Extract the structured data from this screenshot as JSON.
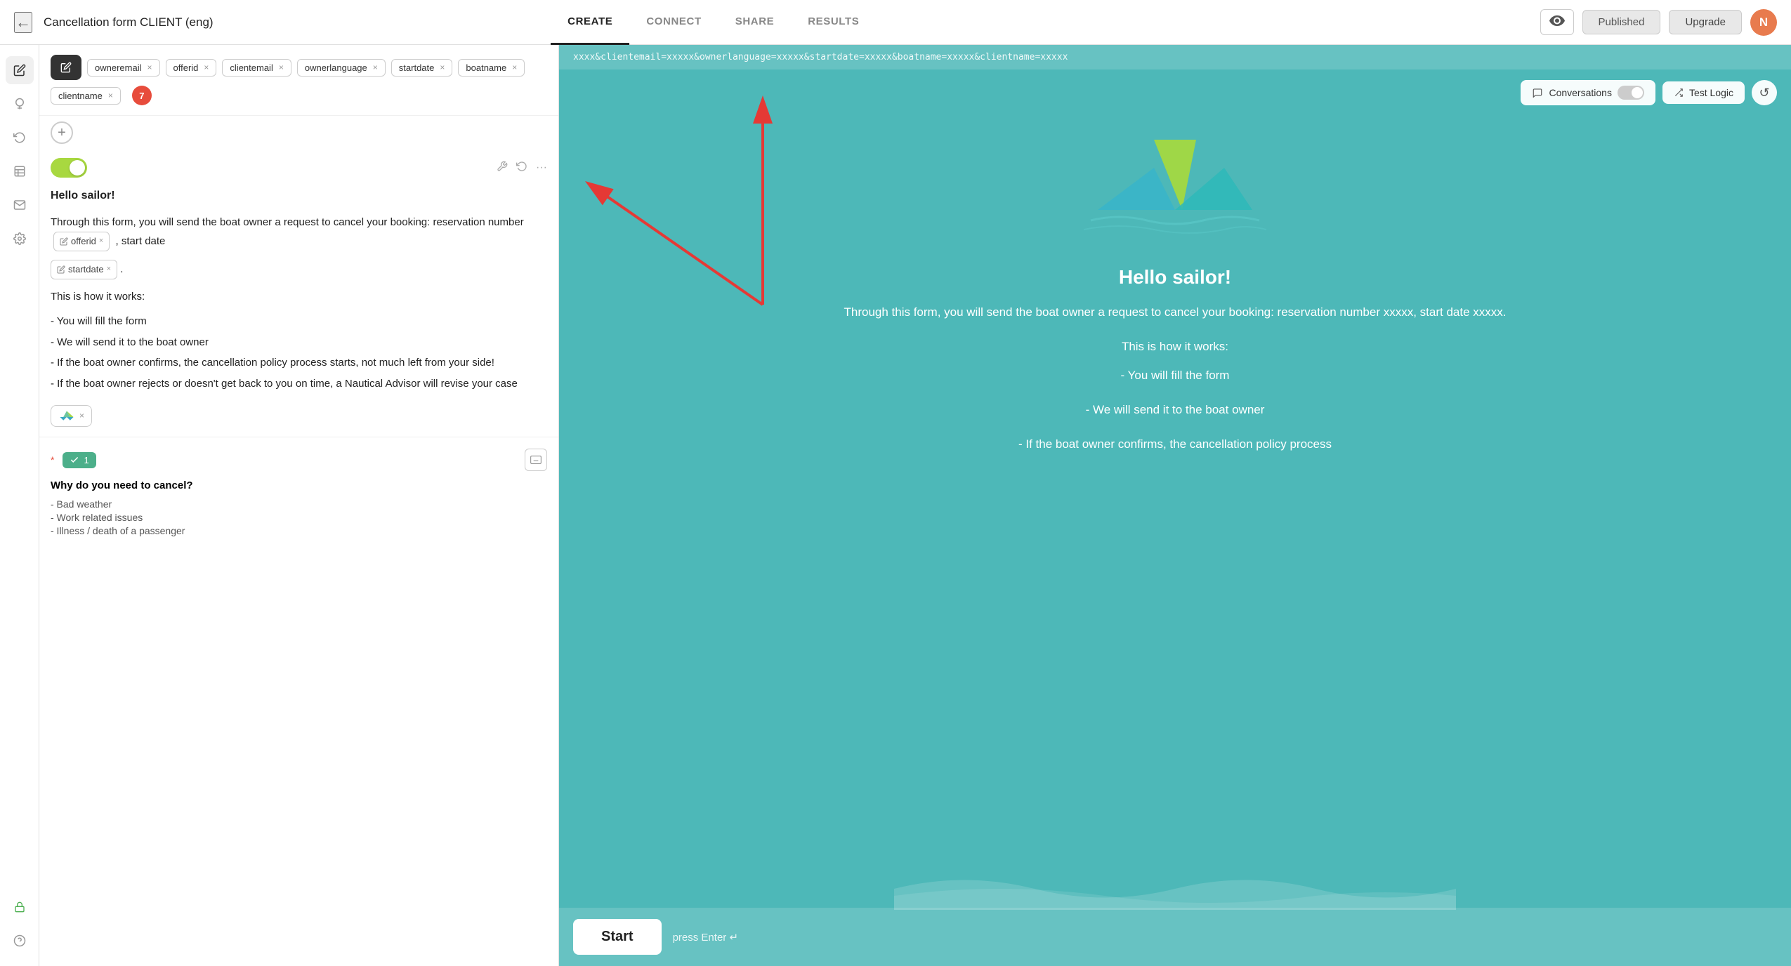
{
  "app": {
    "title": "Cancellation form CLIENT (eng)",
    "back_icon": "←"
  },
  "navbar": {
    "tabs": [
      {
        "id": "create",
        "label": "CREATE",
        "active": true
      },
      {
        "id": "connect",
        "label": "CONNECT",
        "active": false
      },
      {
        "id": "share",
        "label": "SHARE",
        "active": false
      },
      {
        "id": "results",
        "label": "RESULTS",
        "active": false
      }
    ],
    "published_label": "Published",
    "upgrade_label": "Upgrade",
    "avatar_letter": "N",
    "preview_icon": "👁"
  },
  "sidebar": {
    "icons": [
      {
        "id": "edit",
        "symbol": "✏️",
        "active": true
      },
      {
        "id": "theme",
        "symbol": "💧",
        "active": false
      },
      {
        "id": "logic",
        "symbol": "↩",
        "active": false
      },
      {
        "id": "table",
        "symbol": "▦",
        "active": false
      },
      {
        "id": "email",
        "symbol": "✉",
        "active": false
      },
      {
        "id": "settings",
        "symbol": "⚙",
        "active": false
      },
      {
        "id": "lock",
        "symbol": "🔒",
        "active": false
      },
      {
        "id": "help",
        "symbol": "?",
        "active": false
      }
    ]
  },
  "variable_bar": {
    "variables": [
      "owneremail",
      "offerid",
      "clientemail",
      "ownerlanguage",
      "startdate",
      "boatname",
      "clientname"
    ],
    "badge_count": "7"
  },
  "block1": {
    "greeting": "Hello sailor!",
    "paragraph1": "Through this form, you will send the boat owner a request to cancel your booking: reservation number",
    "var1": "offerid",
    "text_between": ", start date",
    "var2": "startdate",
    "period": ".",
    "paragraph2": "This is how it works:",
    "list_items": [
      "- You will fill the form",
      "- We will send it to the boat owner",
      "- If the boat owner confirms, the cancellation policy process starts, not much left from your side!",
      "- If the boat owner rejects or doesn't get back to you on time, a Nautical Advisor will revise your case"
    ],
    "image_alt": "boat logo"
  },
  "block2": {
    "question": "Why do you need to cancel?",
    "choice_label": "1",
    "answer_items": [
      "- Bad weather",
      "- Work related issues",
      "- Illness / death of a passenger"
    ]
  },
  "preview": {
    "url": "xxxx&clientemail=xxxxx&ownerlanguage=xxxxx&startdate=xxxxx&boatname=xxxxx&clientname=xxxxx",
    "conversations_label": "Conversations",
    "test_logic_label": "Test Logic",
    "greeting": "Hello sailor!",
    "paragraph": "Through this form, you will send the boat owner a request to cancel your booking: reservation number xxxxx, start date xxxxx.",
    "how_it_works": "This is how it works:",
    "list_items": [
      "- You will fill the form",
      "- We will send it to the boat owner",
      "- If the boat owner confirms, the cancellation policy process"
    ],
    "start_button": "Start",
    "press_enter": "press Enter ↵"
  }
}
